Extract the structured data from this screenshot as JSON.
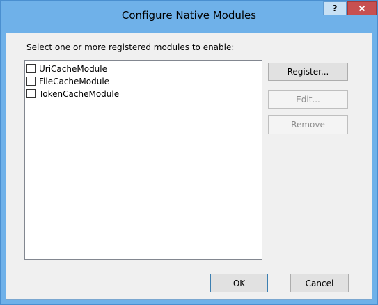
{
  "window": {
    "title": "Configure Native Modules",
    "help_label": "?",
    "close_label": "x"
  },
  "dialog": {
    "instruction": "Select one or more registered modules to enable:",
    "modules": [
      {
        "label": "UriCacheModule",
        "checked": false
      },
      {
        "label": "FileCacheModule",
        "checked": false
      },
      {
        "label": "TokenCacheModule",
        "checked": false
      }
    ]
  },
  "buttons": {
    "register": "Register...",
    "edit": "Edit...",
    "remove": "Remove",
    "ok": "OK",
    "cancel": "Cancel"
  },
  "icons": {
    "help": "help-icon",
    "close": "close-icon"
  },
  "colors": {
    "frame": "#6fb1e9",
    "close_button": "#c75050",
    "dialog_background": "#f0f0f0"
  }
}
